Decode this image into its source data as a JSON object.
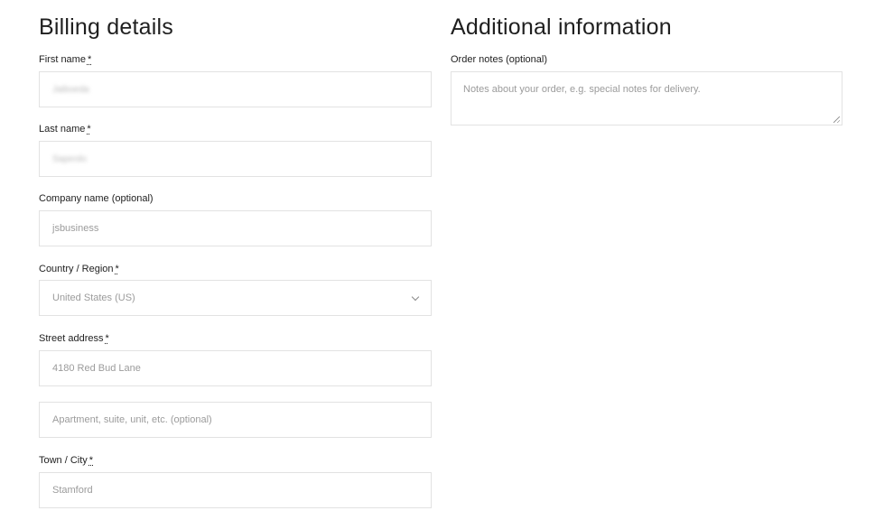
{
  "billing": {
    "title": "Billing details",
    "first_name": {
      "label": "First name",
      "required": "*",
      "value": "Jaiboeda"
    },
    "last_name": {
      "label": "Last name",
      "required": "*",
      "value": "Saperdo"
    },
    "company": {
      "label": "Company name (optional)",
      "value": "jsbusiness"
    },
    "country": {
      "label": "Country / Region",
      "required": "*",
      "value": "United States (US)"
    },
    "street": {
      "label": "Street address",
      "required": "*",
      "value": "4180 Red Bud Lane",
      "line2_placeholder": "Apartment, suite, unit, etc. (optional)"
    },
    "city": {
      "label": "Town / City",
      "required": "*",
      "value": "Stamford"
    }
  },
  "additional": {
    "title": "Additional information",
    "notes_label": "Order notes (optional)",
    "notes_placeholder": "Notes about your order, e.g. special notes for delivery."
  }
}
